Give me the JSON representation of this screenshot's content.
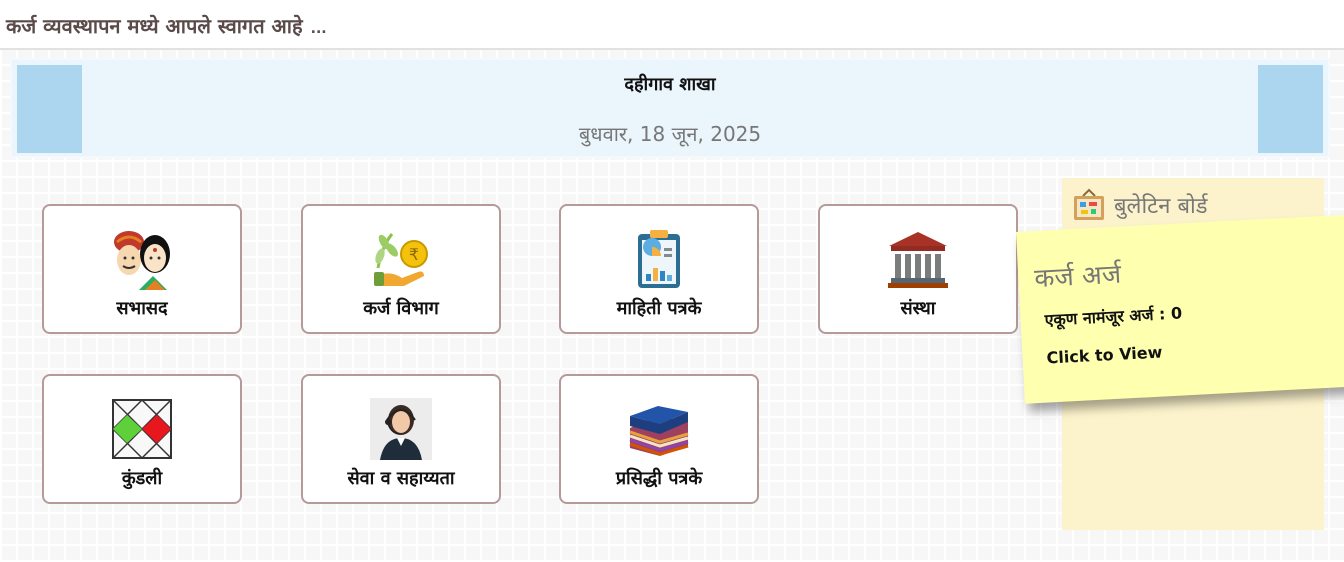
{
  "header": {
    "title": "कर्ज व्यवस्थापन मध्ये आपले स्वागत आहे",
    "ellipsis": "..."
  },
  "branch": {
    "name": "दहीगाव शाखा",
    "date": "बुधवार, 18 जून, 2025"
  },
  "tiles": [
    {
      "label": "सभासद",
      "icon": "members-icon"
    },
    {
      "label": "कर्ज विभाग",
      "icon": "loan-department-icon"
    },
    {
      "label": "माहिती पत्रके",
      "icon": "information-report-icon"
    },
    {
      "label": "संस्था",
      "icon": "institution-building-icon"
    },
    {
      "label": "कुंडली",
      "icon": "kundali-chart-icon"
    },
    {
      "label": "सेवा व सहाय्यता",
      "icon": "support-agent-icon"
    },
    {
      "label": "प्रसिद्धी पत्रके",
      "icon": "publication-stack-icon"
    }
  ],
  "bulletin": {
    "title": "बुलेटिन बोर्ड",
    "icon": "bulletin-board-icon",
    "note": {
      "title": "कर्ज अर्ज",
      "count_text": "एकूण नामंजूर अर्ज : 0",
      "link_text": "Click to View"
    }
  },
  "colors": {
    "banner_bg": "#eaf5fc",
    "banner_square": "#acd5f0",
    "tile_border": "#b69a9a",
    "bulletin_bg": "#fcf3cc",
    "sticky_bg": "#ffffb0",
    "header_text": "#5a4a4a"
  }
}
